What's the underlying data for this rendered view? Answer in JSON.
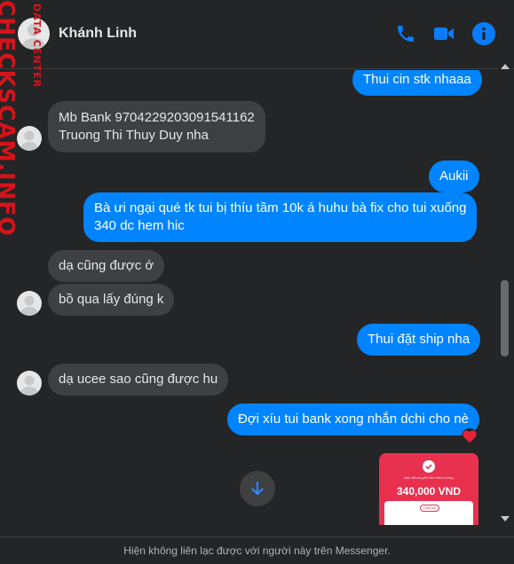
{
  "header": {
    "contact_name": "Khánh Linh",
    "icons": [
      "phone-icon",
      "video-camera-icon",
      "info-icon"
    ]
  },
  "watermark": {
    "main": "CHECKSCAM.INFO",
    "sub": "DATA CENTER"
  },
  "messages": [
    {
      "side": "out",
      "text": "Thui cin stk nhaaa"
    },
    {
      "side": "in",
      "lines": [
        "Mb Bank 9704229203091541162",
        "Truong Thi Thuy Duy nha"
      ]
    },
    {
      "side": "out",
      "text": "Aukii"
    },
    {
      "side": "out",
      "lines": [
        "Bà ưi ngại qué tk tui bị thíu tầm 10k á huhu bà fix cho tui xuống",
        "340 dc hem hic"
      ]
    },
    {
      "side": "in",
      "text": "dạ cũng được ớ"
    },
    {
      "side": "in",
      "text": "bồ qua lấy đúng k"
    },
    {
      "side": "out",
      "text": "Thui đặt ship nha"
    },
    {
      "side": "in",
      "text": "dạ ucee sao cũng được hu"
    },
    {
      "side": "out",
      "text": "Đợi xíu tui bank xong nhắn dchi cho nè",
      "reaction": "❤️"
    }
  ],
  "transfer_image": {
    "status_text": "Bạn đã chuyển tiền thành công",
    "amount": "340,000 VND",
    "button": "Chia sẻ"
  },
  "footer": {
    "notice": "Hiện không liên lạc được với người này trên Messenger."
  },
  "colors": {
    "accent": "#0084ff",
    "background": "#242526",
    "incoming_bubble": "#3e4042",
    "watermark": "#d5141a"
  }
}
